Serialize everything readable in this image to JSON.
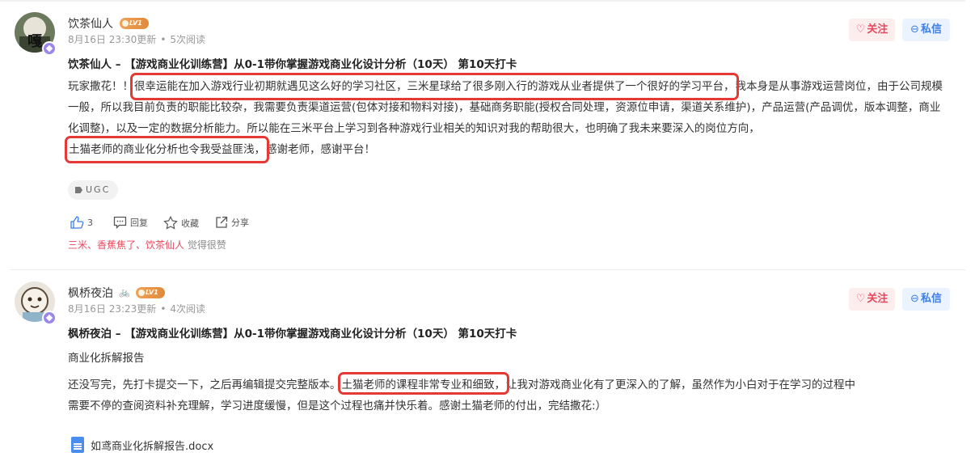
{
  "posts": [
    {
      "username": "饮茶仙人",
      "level": "LV1",
      "meta_time": "8月16日 23:30更新",
      "meta_reads": "5次阅读",
      "follow_label": "关注",
      "message_label": "私信",
      "title": "饮茶仙人 – 【游戏商业化训练营】从0-1带你掌握游戏商业化设计分析（10天） 第10天打卡",
      "body_prefix": "玩家撒花！！",
      "highlight_1": "很幸运能在加入游戏行业初期就遇见这么好的学习社区，三米星球给了很多刚入行的游戏从业者提供了一个很好的学习平台，",
      "body_middle": "我本身是从事游戏运营岗位，由于公司规模一般，所以我目前负责的职能比较杂，我需要负责渠道运营(包体对接和物料对接)，基础商务职能(授权合同处理，资源位申请，渠道关系维护)，产品运营(产品调优，版本调整，商业化调整)，以及一定的数据分析能力。所以能在三米平台上学习到各种游戏行业相关的知识对我的帮助很大，也明确了我未来要深入的岗位方向，",
      "highlight_2": "土猫老师的商业化分析也令我受益匪浅，",
      "body_suffix": "感谢老师，感谢平台！",
      "tag": "UGC",
      "like_count": "3",
      "reply_label": "回复",
      "collect_label": "收藏",
      "share_label": "分享",
      "likers": "三米、香蕉焦了、饮茶仙人",
      "likers_suffix": "觉得很赞"
    },
    {
      "username": "枫桥夜泊",
      "level": "LV1",
      "meta_time": "8月16日 23:23更新",
      "meta_reads": "4次阅读",
      "follow_label": "关注",
      "message_label": "私信",
      "title": "枫桥夜泊 – 【游戏商业化训练营】从0-1带你掌握游戏商业化设计分析（10天） 第10天打卡",
      "subtitle": "商业化拆解报告",
      "line1_prefix": "还没写完，先打卡提交一下，之后再编辑提交完整版本。",
      "highlight": "土猫老师的课程非常专业和细致，",
      "line1_suffix": "让我对游戏商业化有了更深入的了解，虽然作为小白对于在学习的过程中",
      "line2": "需要不停的查阅资料补充理解，学习进度缓慢，但是这个过程也痛并快乐着。感谢土猫老师的付出，完结撒花:）",
      "attachment": "如鸢商业化拆解报告.docx"
    }
  ],
  "colors": {
    "accent_red": "#e53935",
    "follow": "#e5485d",
    "message": "#3e7ee6",
    "level": "#f0a256",
    "doc": "#4a8df1"
  },
  "icons": [
    "heart-icon",
    "chat-icon",
    "thumb-up-icon",
    "comment-icon",
    "star-icon",
    "share-icon",
    "tag-icon",
    "doc-icon",
    "bike-icon"
  ]
}
